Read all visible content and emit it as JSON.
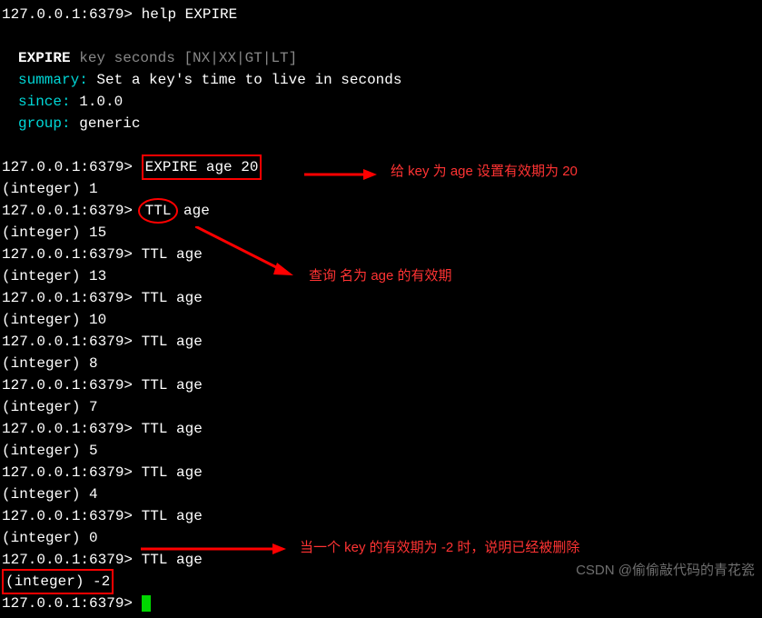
{
  "prompt": "127.0.0.1:6379>",
  "help_cmd": "help EXPIRE",
  "help_block": {
    "cmd_name": "EXPIRE",
    "cmd_args": "key seconds [NX|XX|GT|LT]",
    "summary_label": "summary:",
    "summary_text": "Set a key's time to live in seconds",
    "since_label": "since:",
    "since_text": "1.0.0",
    "group_label": "group:",
    "group_text": "generic"
  },
  "expire_cmd": "EXPIRE age 20",
  "expire_result": "(integer) 1",
  "ttl_cmd": "TTL age",
  "ttl_hl": "TTL",
  "ttl_hl_suffix": " age",
  "ttl_results": [
    "(integer) 15",
    "(integer) 13",
    "(integer) 10",
    "(integer) 8",
    "(integer) 7",
    "(integer) 5",
    "(integer) 4",
    "(integer) 0"
  ],
  "ttl_final": "(integer) -2",
  "annotations": {
    "a1": "给 key 为 age 设置有效期为 20",
    "a2": "查询 名为 age 的有效期",
    "a3": "当一个 key 的有效期为 -2 时，说明已经被删除"
  },
  "watermark": "CSDN @偷偷敲代码的青花瓷"
}
